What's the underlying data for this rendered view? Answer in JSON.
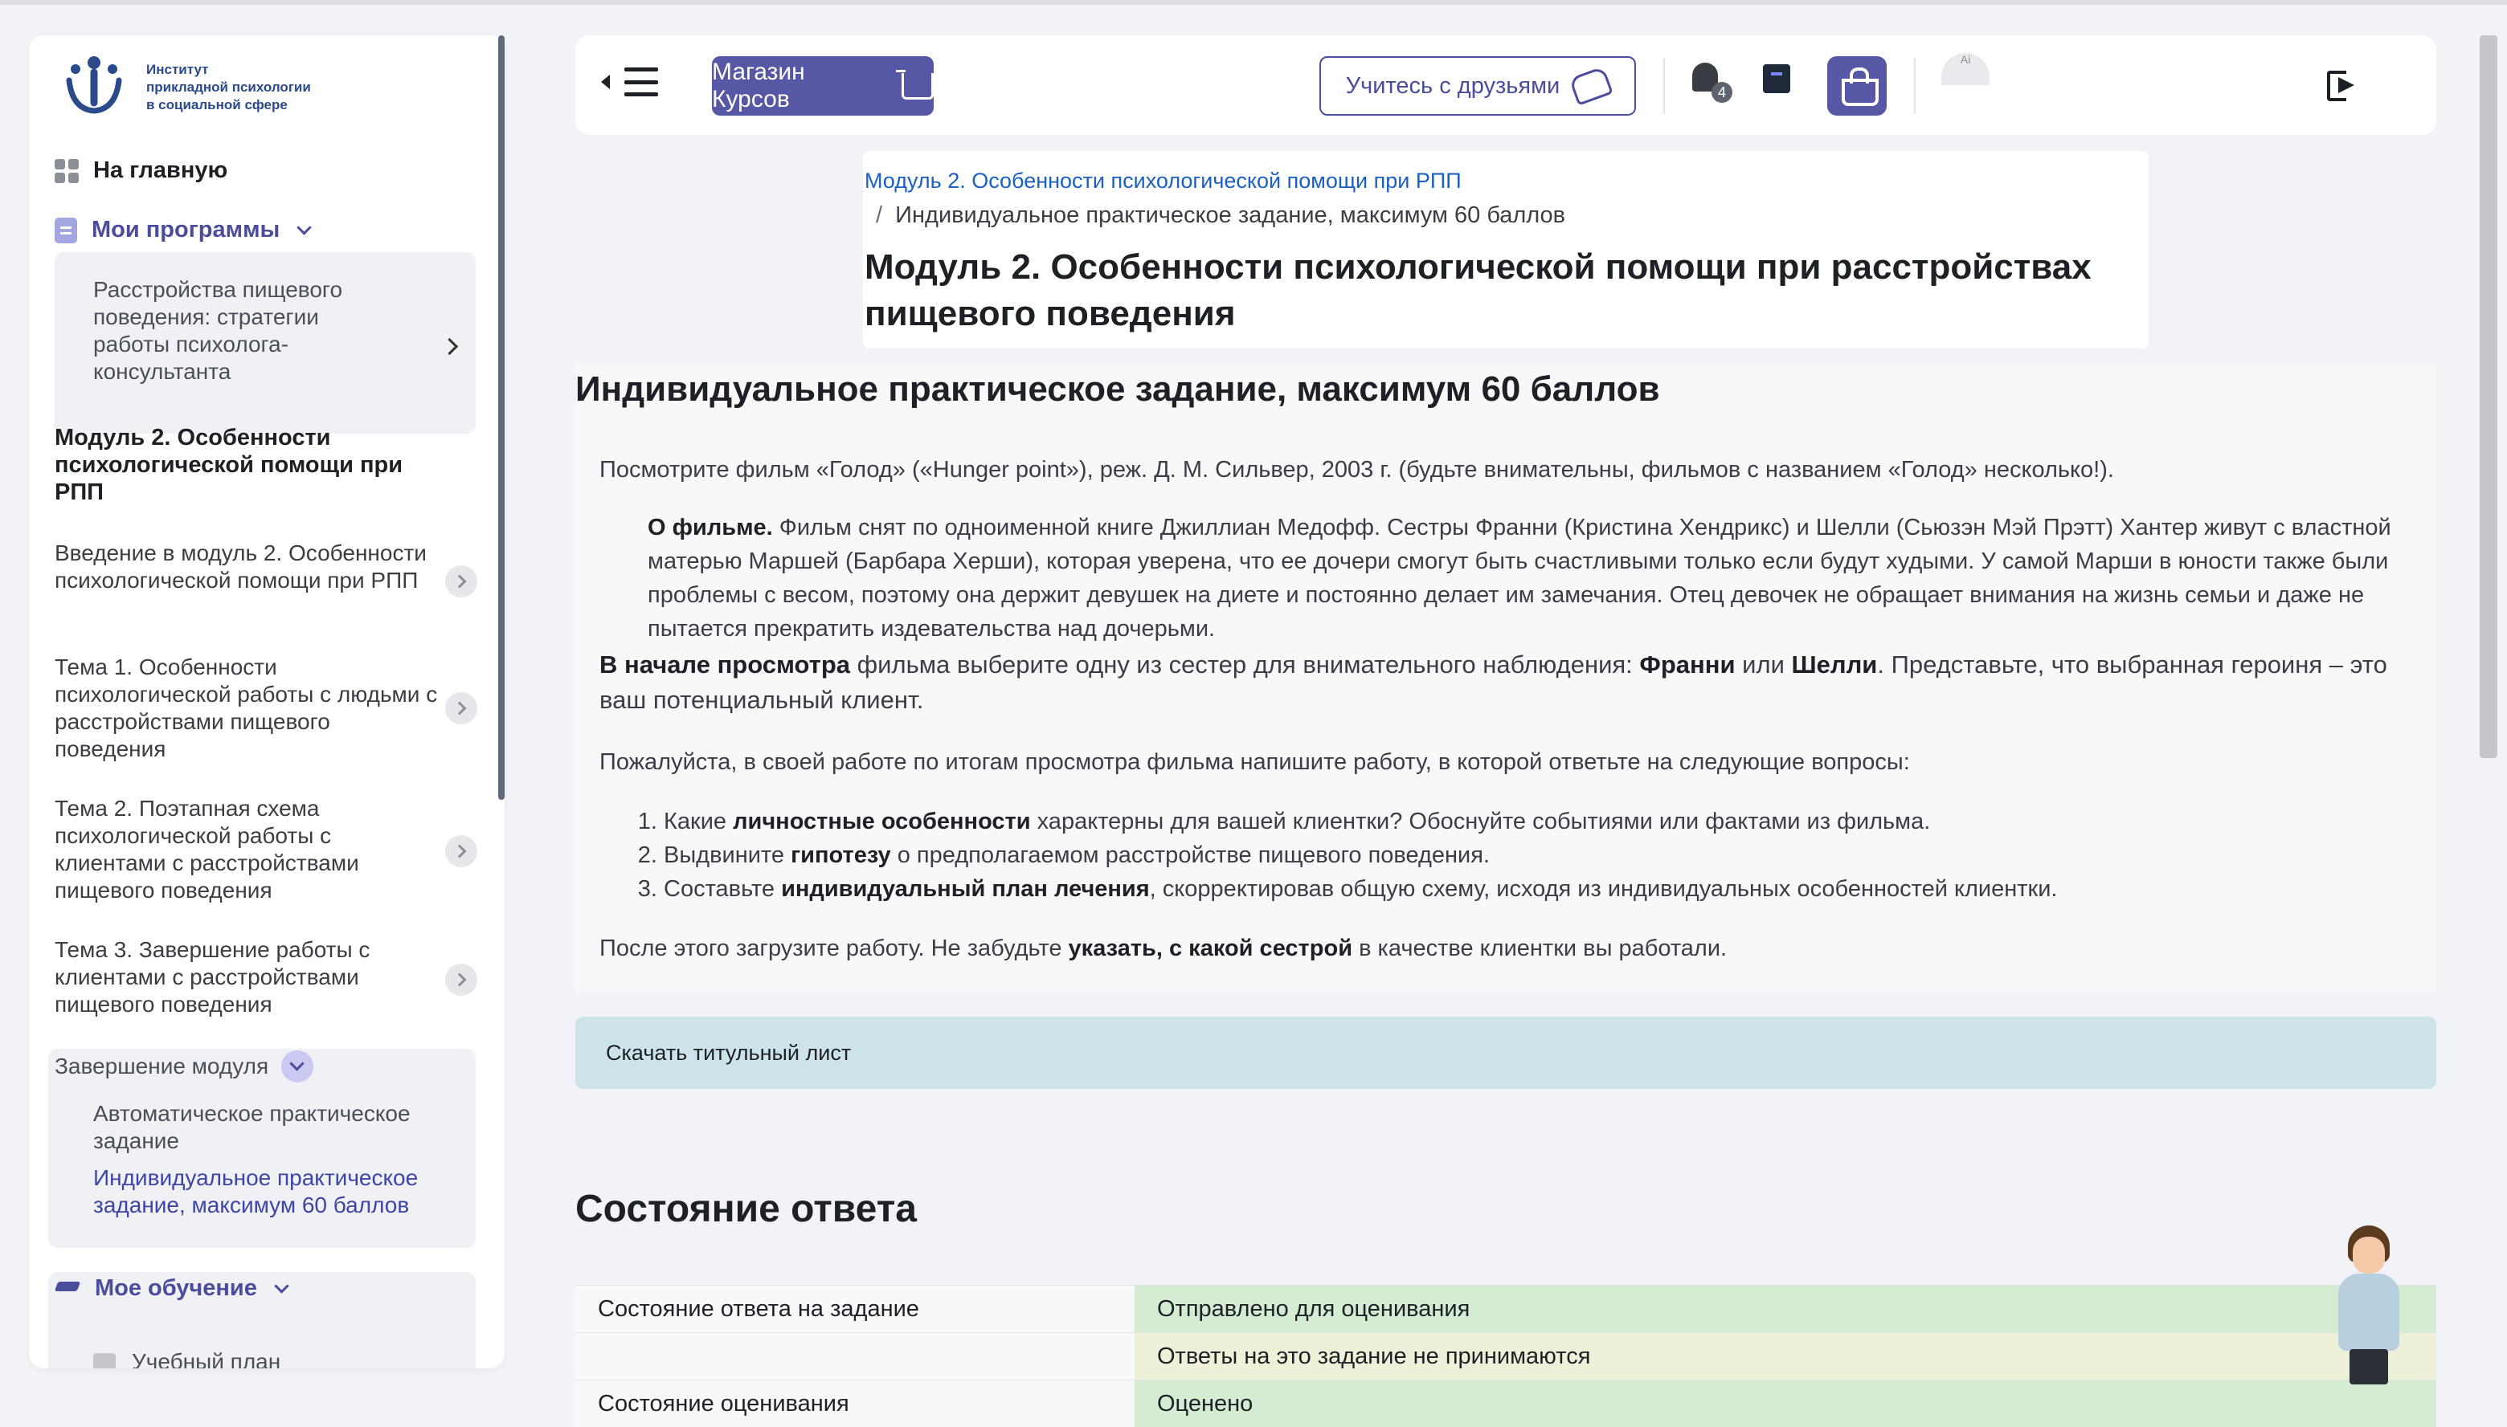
{
  "logo": {
    "lines": [
      "Институт",
      "прикладной психологии",
      "в социальной сфере"
    ]
  },
  "sidebar": {
    "home": "На главную",
    "my_programs": "Мои программы",
    "program": "Расстройства пищевого поведения: стратегии работы психолога-консультанта",
    "module_title": "Модуль 2. Особенности психологической помощи при РПП",
    "topics": [
      "Введение в модуль 2. Особенности психологической помощи при РПП",
      "Тема 1. Особенности психологической работы с людьми с расстройствами пищевого поведения",
      "Тема 2. Поэтапная схема психологической работы с клиентами с расстройствами пищевого поведения",
      "Тема 3. Завершение работы с клиентами с расстройствами пищевого поведения"
    ],
    "finish_section": "Завершение модуля",
    "finish_items": [
      "Автоматическое практическое задание",
      "Индивидуальное практическое задание, максимум 60 баллов"
    ],
    "my_learning": "Мое обучение",
    "plan": "Учебный план"
  },
  "header": {
    "shop": "Магазин Курсов",
    "friends": "Учитесь с друзьями",
    "notifications_count": "4",
    "avatar_text": "Ai"
  },
  "breadcrumb": {
    "module": "Модуль 2. Особенности психологической помощи при РПП",
    "current": "Индивидуальное практическое задание, максимум 60 баллов"
  },
  "page_title": "Модуль 2. Особенности психологической помощи при расстройствах пищевого поведения",
  "assignment": {
    "title": "Индивидуальное практическое задание, максимум 60 баллов",
    "intro": "Посмотрите фильм «Голод» («Hunger point»), реж. Д. М. Сильвер, 2003 г. (будьте внимательны, фильмов с названием «Голод» несколько!).",
    "about_label": "О фильме.",
    "about_text": " Фильм снят по одноименной книге Джиллиан Медофф. Сестры Франни (Кристина Хендрикс) и Шелли (Сьюзэн Мэй Прэтт) Хантер живут с властной матерью Маршей (Барбара Херши), которая уверена, что ее дочери смогут быть счастливыми только если будут худыми. У самой Марши в юности также были проблемы с весом, поэтому она держит девушек на диете и постоянно делает им замечания. Отец девочек не обращает внимания на жизнь семьи и даже не пытается прекратить издевательства над дочерьми.",
    "choose": {
      "b1": "В начале просмотра",
      "t1": " фильма выберите одну из сестер для внимательного наблюдения: ",
      "b2": "Франни",
      "t2": " или ",
      "b3": "Шелли",
      "t3": ". Представьте, что выбранная героиня – это ваш потенциальный клиент."
    },
    "please": "Пожалуйста, в своей работе по итогам просмотра фильма напишите работу, в которой ответьте на следующие вопросы:",
    "q1": {
      "pre": "Какие ",
      "bold": "личностные особенности",
      "post": " характерны для вашей клиентки? Обоснуйте событиями или фактами из фильма."
    },
    "q2": {
      "pre": "Выдвините ",
      "bold": "гипотезу",
      "post": " о предполагаемом расстройстве пищевого поведения."
    },
    "q3": {
      "pre": "Составьте ",
      "bold": "индивидуальный план лечения",
      "post": ", скорректировав общую схему, исходя из индивидуальных особенностей клиентки."
    },
    "after": {
      "pre": "После этого загрузите работу. Не забудьте ",
      "b1": "указать",
      "mid": ", ",
      "b2": "с какой сестрой",
      "post": " в качестве клиентки вы работали."
    }
  },
  "download": "Скачать титульный лист",
  "status": {
    "title": "Состояние ответа",
    "rows": [
      {
        "label": "Состояние ответа на задание",
        "value": "Отправлено для оценивания"
      },
      {
        "label": "",
        "value": "Ответы на это задание не принимаются"
      },
      {
        "label": "Состояние оценивания",
        "value": "Оценено"
      }
    ]
  }
}
